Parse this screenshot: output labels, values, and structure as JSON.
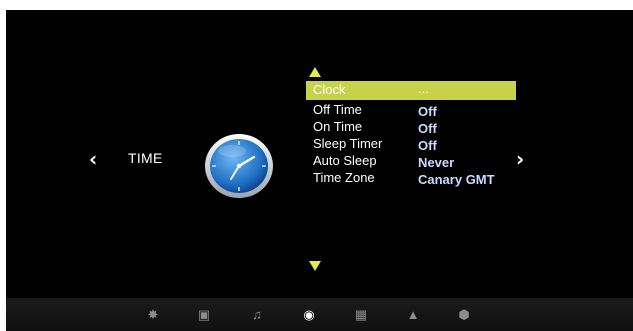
{
  "section": {
    "title": "TIME",
    "icon": "clock-icon"
  },
  "navigation": {
    "left_arrow": "‹",
    "right_arrow": "›",
    "up_indicator": "triangle-up-icon",
    "down_indicator": "triangle-down-icon"
  },
  "menu": {
    "items": [
      {
        "label": "Clock",
        "value": "...",
        "selected": true
      },
      {
        "label": "Off Time",
        "value": "Off",
        "selected": false
      },
      {
        "label": "On Time",
        "value": "Off",
        "selected": false
      },
      {
        "label": "Sleep Timer",
        "value": "Off",
        "selected": false
      },
      {
        "label": "Auto Sleep",
        "value": "Never",
        "selected": false
      },
      {
        "label": "Time Zone",
        "value": "Canary GMT",
        "selected": false
      }
    ]
  },
  "bottom_bar": {
    "icons": [
      {
        "name": "picture-icon",
        "glyph": "✸",
        "active": false
      },
      {
        "name": "channel-icon",
        "glyph": "▣",
        "active": false
      },
      {
        "name": "sound-icon",
        "glyph": "♫",
        "active": false
      },
      {
        "name": "time-icon",
        "glyph": "◉",
        "active": true
      },
      {
        "name": "option-icon",
        "glyph": "▦",
        "active": false
      },
      {
        "name": "lock-icon",
        "glyph": "▲",
        "active": false
      },
      {
        "name": "setup-icon",
        "glyph": "⬢",
        "active": false
      }
    ]
  },
  "colors": {
    "highlight": "#c7d14a",
    "arrow": "#e8ea4b",
    "value_text": "#c8dcff",
    "background": "#000000"
  }
}
